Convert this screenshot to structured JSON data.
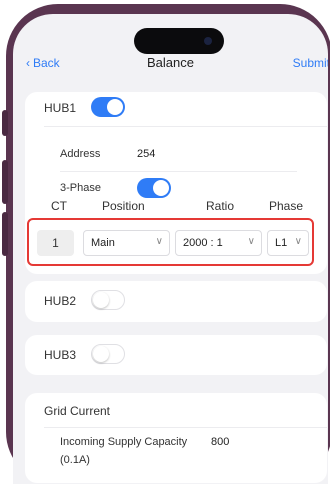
{
  "nav": {
    "back_label": "Back",
    "title": "Balance",
    "submit_label": "Submit"
  },
  "hub1": {
    "label": "HUB1",
    "enabled": true,
    "address_label": "Address",
    "address_value": "254",
    "three_phase_label": "3-Phase",
    "three_phase_enabled": true,
    "columns": {
      "ct": "CT",
      "position": "Position",
      "ratio": "Ratio",
      "phase": "Phase"
    },
    "row": {
      "ct": "1",
      "position": "Main",
      "ratio": "2000 : 1",
      "phase": "L1"
    }
  },
  "hub2": {
    "label": "HUB2",
    "enabled": false
  },
  "hub3": {
    "label": "HUB3",
    "enabled": false
  },
  "grid": {
    "title": "Grid Current",
    "supply_label": "Incoming Supply Capacity",
    "supply_unit": "(0.1A)",
    "supply_value": "800"
  },
  "colors": {
    "accent": "#2f7cf6",
    "highlight": "#e53935",
    "frame": "#5a3550"
  },
  "icons": {
    "back": "chevron-left-icon",
    "dropdown": "chevron-down-icon"
  }
}
